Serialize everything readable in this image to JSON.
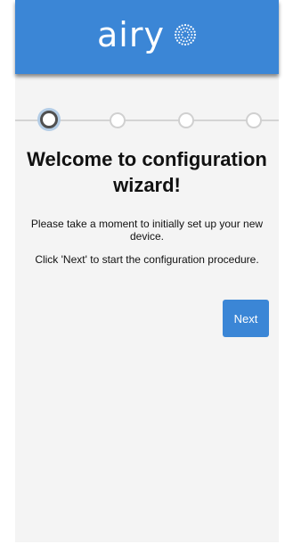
{
  "header": {
    "logo_text": "airy",
    "logo_icon": "sunburst-dots-icon",
    "background_color": "#3b86d6"
  },
  "stepper": {
    "total_steps": 4,
    "current_step": 1
  },
  "welcome": {
    "title": "Welcome to configuration wizard!",
    "paragraph_1": "Please take a moment to initially set up your new device.",
    "paragraph_2": "Click 'Next' to start the configuration procedure."
  },
  "actions": {
    "next_label": "Next"
  }
}
